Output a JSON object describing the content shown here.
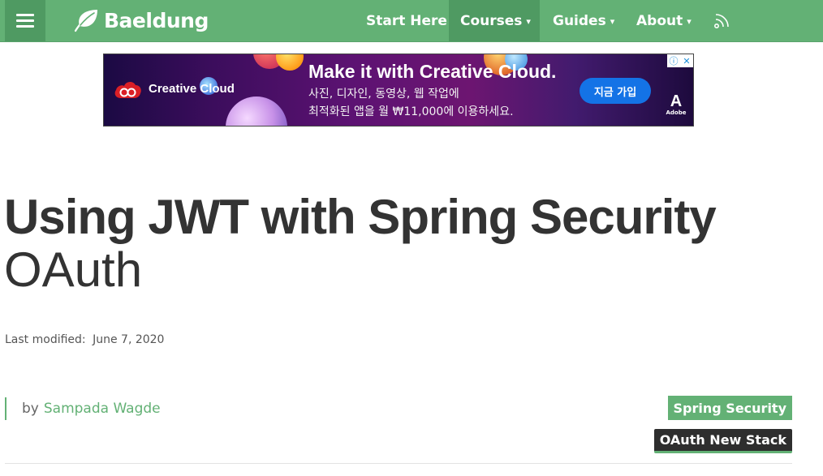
{
  "nav": {
    "logo_text": "Baeldung",
    "items": [
      {
        "label": "Start Here",
        "caret": false,
        "active": false
      },
      {
        "label": "Courses",
        "caret": true,
        "active": true
      },
      {
        "label": "Guides",
        "caret": true,
        "active": false
      },
      {
        "label": "About",
        "caret": true,
        "active": false
      }
    ],
    "caret_glyph": "▾"
  },
  "ad": {
    "brand": "Creative Cloud",
    "headline": "Make it with Creative Cloud.",
    "subline_1": "사진, 디자인, 동영상, 웹 작업에",
    "subline_2": "최적화된 앱을 월 ₩11,000에 이용하세요.",
    "cta": "지금 가입",
    "vendor_mark": "A",
    "vendor_name": "Adobe",
    "choices_info": "ⓘ",
    "choices_close": "✕"
  },
  "article": {
    "title_line1": "Using JWT with Spring Security",
    "title_line2": "OAuth",
    "modified_label": "Last modified:",
    "modified_date": "June 7, 2020",
    "by_label": "by",
    "author": "Sampada Wagde",
    "tags": [
      "Spring Security",
      "OAuth New Stack"
    ]
  },
  "colors": {
    "brand_green": "#63b175",
    "nav_active": "#4f9a62",
    "cta_blue": "#1473e6",
    "dark_tag": "#2e2e2e"
  }
}
